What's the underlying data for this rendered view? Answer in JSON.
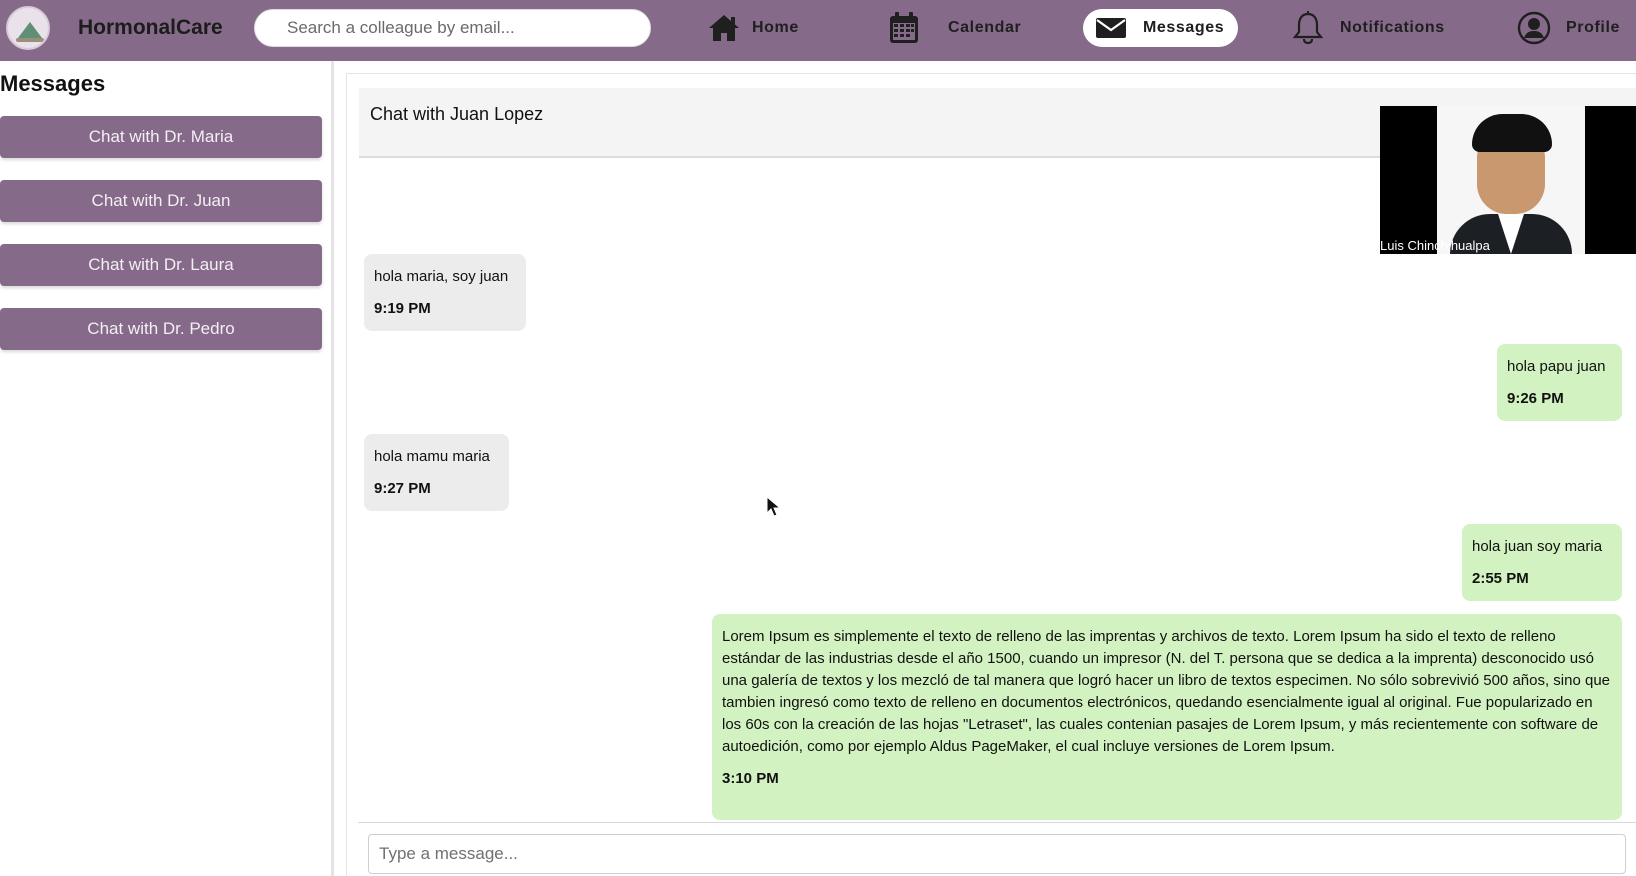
{
  "app": {
    "name": "HormonalCare"
  },
  "search": {
    "placeholder": "Search a colleague by email..."
  },
  "nav": [
    {
      "label": "Home",
      "icon": "home-icon"
    },
    {
      "label": "Calendar",
      "icon": "calendar-icon"
    },
    {
      "label": "Messages",
      "icon": "mail-icon",
      "active": true
    },
    {
      "label": "Notifications",
      "icon": "bell-icon"
    },
    {
      "label": "Profile",
      "icon": "user-circle-icon"
    }
  ],
  "sidebar": {
    "title": "Messages",
    "items": [
      {
        "label": "Chat with Dr. Maria"
      },
      {
        "label": "Chat with Dr. Juan"
      },
      {
        "label": "Chat with Dr. Laura"
      },
      {
        "label": "Chat with Dr. Pedro"
      }
    ]
  },
  "chat": {
    "title": "Chat with Juan Lopez",
    "messages": [
      {
        "direction": "received",
        "text": "hola maria, soy juan",
        "time": "9:19 PM"
      },
      {
        "direction": "sent",
        "text": "hola papu juan",
        "time": "9:26 PM"
      },
      {
        "direction": "received",
        "text": "hola mamu maria",
        "time": "9:27 PM"
      },
      {
        "direction": "sent",
        "text": "hola juan soy maria",
        "time": "2:55 PM"
      },
      {
        "direction": "sent",
        "text": "Lorem Ipsum es simplemente el texto de relleno de las imprentas y archivos de texto. Lorem Ipsum ha sido el texto de relleno estándar de las industrias desde el año 1500, cuando un impresor (N. del T. persona que se dedica a la imprenta) desconocido usó una galería de textos y los mezcló de tal manera que logró hacer un libro de textos especimen. No sólo sobrevivió 500 años, sino que tambien ingresó como texto de relleno en documentos electrónicos, quedando esencialmente igual al original. Fue popularizado en los 60s con la creación de las hojas \"Letraset\", las cuales contenian pasajes de Lorem Ipsum, y más recientemente con software de autoedición, como por ejemplo Aldus PageMaker, el cual incluye versiones de Lorem Ipsum.",
        "time": "3:10 PM"
      }
    ],
    "composer_placeholder": "Type a message..."
  },
  "video_call": {
    "participant": "Luis Chinchihualpa"
  },
  "colors": {
    "primary": "#866a8a",
    "sent_bubble": "#d3f2c2",
    "received_bubble": "#ececec"
  }
}
